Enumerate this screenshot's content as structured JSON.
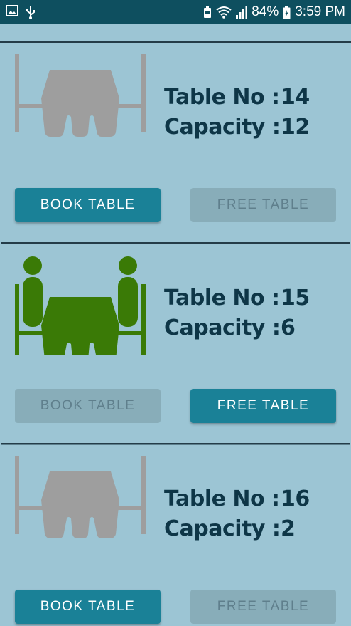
{
  "status_bar": {
    "battery": "84%",
    "time": "3:59 PM",
    "icons": [
      "gallery-icon",
      "usb-icon",
      "battery-saver-icon",
      "wifi-icon",
      "signal-icon",
      "battery-icon"
    ]
  },
  "labels": {
    "table_no": "Table No :",
    "capacity": "Capacity :"
  },
  "tables": [
    {
      "table_no": "14",
      "capacity": "12",
      "status": "free",
      "icon": "empty-table-icon",
      "icon_color": "#9e9e9e",
      "book_label": "BOOK TABLE",
      "free_label": "FREE TABLE",
      "book_enabled": true,
      "free_enabled": false
    },
    {
      "table_no": "15",
      "capacity": "6",
      "status": "occupied",
      "icon": "occupied-table-icon",
      "icon_color": "#3a7a06",
      "book_label": "BOOK TABLE",
      "free_label": "FREE TABLE",
      "book_enabled": false,
      "free_enabled": true
    },
    {
      "table_no": "16",
      "capacity": "2",
      "status": "free",
      "icon": "empty-table-icon",
      "icon_color": "#9e9e9e",
      "book_label": "BOOK TABLE",
      "free_label": "FREE TABLE",
      "book_enabled": true,
      "free_enabled": false
    }
  ],
  "colors": {
    "background": "#9cc5d4",
    "status_bar": "#0e4f5f",
    "text_dark": "#0e3647",
    "button_enabled": "#1a8197",
    "button_disabled": "#88adb9"
  }
}
